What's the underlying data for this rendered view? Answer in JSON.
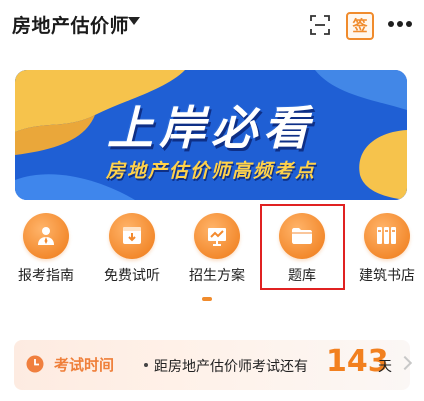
{
  "header": {
    "title": "房地产估价师",
    "sign_label": "签",
    "icons": [
      "chevron-down-icon",
      "scan-icon",
      "sign-in-icon",
      "more-icon"
    ]
  },
  "banner": {
    "title": "上岸必看",
    "subtitle": "房地产估价师高频考点",
    "colors": {
      "background": "#1f5fd4",
      "accent": "#ffd24a"
    }
  },
  "menu": {
    "items": [
      {
        "label": "报考指南",
        "icon": "exam-guide-icon"
      },
      {
        "label": "免费试听",
        "icon": "free-trial-icon"
      },
      {
        "label": "招生方案",
        "icon": "enrollment-plan-icon"
      },
      {
        "label": "题库",
        "icon": "folder-icon"
      },
      {
        "label": "建筑书店",
        "icon": "bookshelf-icon"
      }
    ],
    "highlighted_item": "题库",
    "highlight_color": "#e02121"
  },
  "exam": {
    "label": "考试时间",
    "text": "距房地产估价师考试还有",
    "days": "143",
    "unit": "天",
    "accent": "#f2801f"
  }
}
